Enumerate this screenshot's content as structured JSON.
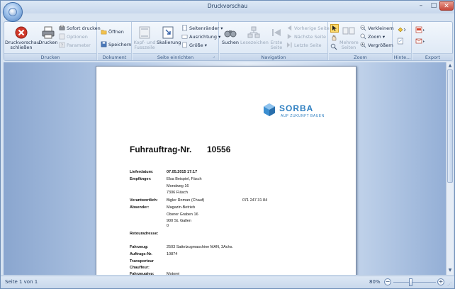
{
  "window": {
    "title": "Druckvorschau",
    "min": "–",
    "max": "□",
    "close": "✕"
  },
  "ribbon": {
    "drucken": {
      "label": "Drucken",
      "close_preview": "Druckvorschau schließen",
      "print": "Drucken",
      "print_now": "Sofort drucken",
      "options": "Optionen",
      "parameters": "Parameter"
    },
    "dokument": {
      "label": "Dokument",
      "open": "Öffnen",
      "save": "Speichern"
    },
    "seite": {
      "label": "Seite einrichten",
      "header_footer": "Kopf- und Fusszeile",
      "scaling": "Skalierung",
      "margins": "Seitenränder",
      "orientation": "Ausrichtung",
      "size": "Größe"
    },
    "navigation": {
      "label": "Navigation",
      "search": "Suchen",
      "bookmarks": "Lesezeichen",
      "first_page": "Erste Seite",
      "prev_page": "Vorherige Seite",
      "next_page": "Nächste Seite",
      "last_page": "Letzte Seite"
    },
    "zoom": {
      "label": "Zoom",
      "multiple_pages": "Mehrere Seiten",
      "zoom_out": "Verkleinern",
      "zoom": "Zoom",
      "zoom_in": "Vergrößern"
    },
    "hintergrund": {
      "label": "Hinte..."
    },
    "export": {
      "label": "Export"
    }
  },
  "document": {
    "logo_text": "SORBA",
    "logo_sub": "AUF ZUKUNFT BAUEN",
    "title": "Fuhrauftrag-Nr.",
    "number": "10556",
    "fields": [
      {
        "label": "Lieferdatum:",
        "value": "07.05.2015 17:17",
        "bold_value": true
      },
      {
        "label": "Empfänger:",
        "value": "Elsa Beispiel, Fäsch"
      },
      {
        "label": "",
        "value": "Mondweg 16"
      },
      {
        "label": "",
        "value": "7306 Fläsch"
      },
      {
        "label": "Verantwortlich:",
        "value": "Bigler Roman (Chauf)",
        "extra": "071 247 31 84"
      },
      {
        "label": "Absender:",
        "value": "Magazin-Betrieb"
      },
      {
        "label": "",
        "value": "Oberer Graben 16"
      },
      {
        "label": "",
        "value": "900     St. Gallen"
      },
      {
        "label": "",
        "value": "0"
      },
      {
        "label": "Retouradresse:",
        "value": ""
      },
      {
        "label": "Fahrzeug:",
        "value": "2503 Sattelzugmaschine MAN, 3Achs."
      },
      {
        "label": "Auftrags-Nr.",
        "value": "10874"
      },
      {
        "label": "Transporteur",
        "value": ""
      },
      {
        "label": "Chauffeur:",
        "value": ""
      },
      {
        "label": "Fahrzeugtyp:",
        "value": "Motorei"
      }
    ]
  },
  "statusbar": {
    "page_info": "Seite 1 von 1",
    "zoom": "80%",
    "minus": "−",
    "plus": "+"
  },
  "colors": {
    "accent": "#2e7fc1",
    "ribbon_bg": "#dae6f4"
  }
}
